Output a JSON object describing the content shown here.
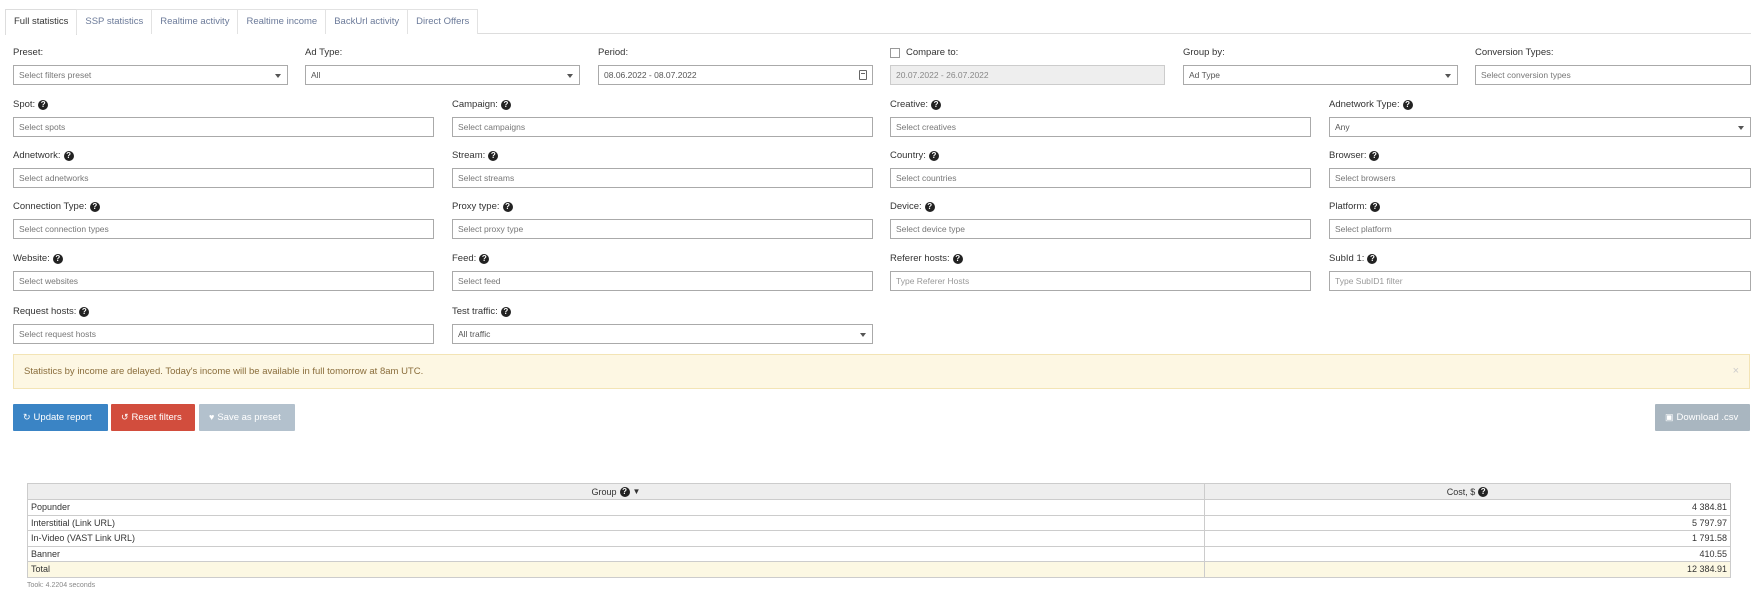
{
  "tabs": [
    "Full statistics",
    "SSP statistics",
    "Realtime activity",
    "Realtime income",
    "BackUrl activity",
    "Direct Offers"
  ],
  "filters": {
    "preset": {
      "label": "Preset:",
      "placeholder": "Select filters preset"
    },
    "ad_type": {
      "label": "Ad Type:",
      "value": "All"
    },
    "period": {
      "label": "Period:",
      "value": "08.06.2022 - 08.07.2022"
    },
    "compare": {
      "label": "Compare to:",
      "value": "20.07.2022 - 26.07.2022"
    },
    "group_by": {
      "label": "Group by:",
      "value": "Ad Type"
    },
    "conversion_types": {
      "label": "Conversion Types:",
      "placeholder": "Select conversion types"
    },
    "spot": {
      "label": "Spot:",
      "placeholder": "Select spots"
    },
    "campaign": {
      "label": "Campaign:",
      "placeholder": "Select campaigns"
    },
    "creative": {
      "label": "Creative:",
      "placeholder": "Select creatives"
    },
    "adnetwork_type": {
      "label": "Adnetwork Type:",
      "value": "Any"
    },
    "adnetwork": {
      "label": "Adnetwork:",
      "placeholder": "Select adnetworks"
    },
    "stream": {
      "label": "Stream:",
      "placeholder": "Select streams"
    },
    "country": {
      "label": "Country:",
      "placeholder": "Select countries"
    },
    "browser": {
      "label": "Browser:",
      "placeholder": "Select browsers"
    },
    "connection_type": {
      "label": "Connection Type:",
      "placeholder": "Select connection types"
    },
    "proxy_type": {
      "label": "Proxy type:",
      "placeholder": "Select proxy type"
    },
    "device": {
      "label": "Device:",
      "placeholder": "Select device type"
    },
    "platform": {
      "label": "Platform:",
      "placeholder": "Select platform"
    },
    "website": {
      "label": "Website:",
      "placeholder": "Select websites"
    },
    "feed": {
      "label": "Feed:",
      "placeholder": "Select feed"
    },
    "referer_hosts": {
      "label": "Referer hosts:",
      "placeholder": "Type Referer Hosts"
    },
    "subid1": {
      "label": "SubId 1:",
      "placeholder": "Type SubID1 filter"
    },
    "request_hosts": {
      "label": "Request hosts:",
      "placeholder": "Select request hosts"
    },
    "test_traffic": {
      "label": "Test traffic:",
      "value": "All traffic"
    }
  },
  "alert": {
    "text": "Statistics by income are delayed. Today's income will be available in full tomorrow at 8am UTC.",
    "close": "×"
  },
  "buttons": {
    "update": "Update report",
    "reset": "Reset filters",
    "save": "Save as preset",
    "download": "Download .csv"
  },
  "table": {
    "headers": {
      "group": "Group",
      "cost": "Cost, $"
    },
    "rows": [
      {
        "group": "Popunder",
        "cost": "4 384.81"
      },
      {
        "group": "Interstitial (Link URL)",
        "cost": "5 797.97"
      },
      {
        "group": "In-Video (VAST Link URL)",
        "cost": "1 791.58"
      },
      {
        "group": "Banner",
        "cost": "410.55"
      }
    ],
    "total": {
      "group": "Total",
      "cost": "12 384.91"
    },
    "took": "Took: 4.2204 seconds"
  },
  "colors": {
    "primary": "#3a84c5",
    "danger": "#d24d3d",
    "disabled": "#b3c1cd",
    "alert_bg": "#fdf7e3",
    "alert_text": "#8a6d3b"
  }
}
